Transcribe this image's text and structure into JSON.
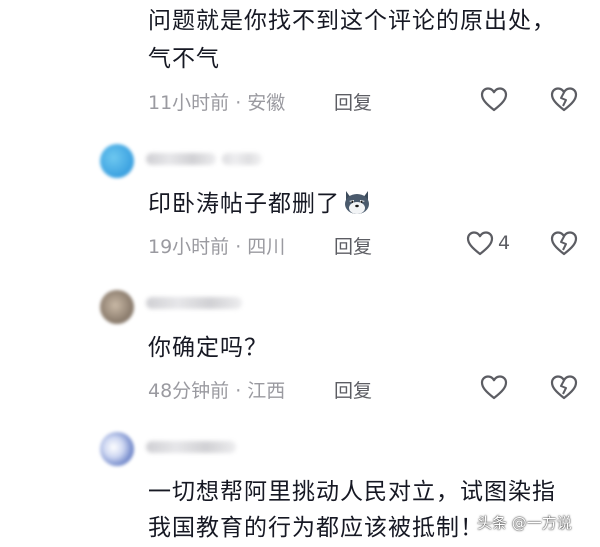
{
  "comments": [
    {
      "text_lines": [
        "问题就是你找不到这个评论的原出处，",
        "气不气"
      ],
      "time": "11小时前",
      "location": "安徽",
      "reply_label": "回复",
      "likes": ""
    },
    {
      "text": "印卧涛帖子都删了",
      "emoji": "husky-face-emoji",
      "time": "19小时前",
      "location": "四川",
      "reply_label": "回复",
      "likes": "4"
    },
    {
      "text": "你确定吗？",
      "time": "48分钟前",
      "location": "江西",
      "reply_label": "回复",
      "likes": ""
    },
    {
      "text_lines": [
        "一切想帮阿里挑动人民对立，试图染指",
        "我国教育的行为都应该被抵制！"
      ]
    }
  ],
  "separator": "·",
  "watermark": "头条 @一方说",
  "colors": {
    "text": "#161823",
    "meta": "#9a9aa0",
    "icon": "#5c5d63",
    "background": "#ffffff"
  },
  "icons": {
    "like": "heart-outline-icon",
    "dislike": "broken-heart-icon"
  }
}
